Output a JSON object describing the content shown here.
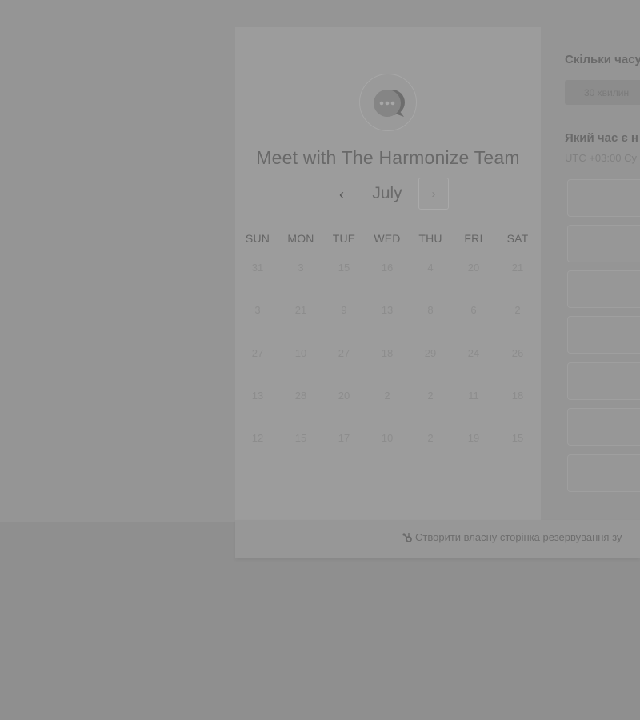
{
  "calendar": {
    "title": "Meet with The Harmonize Team",
    "month": "July",
    "prev_icon": "chevron-left-icon",
    "next_icon": "chevron-right-icon",
    "prev_glyph": "‹",
    "next_glyph": "›",
    "weekdays": [
      "SUN",
      "MON",
      "TUE",
      "WED",
      "THU",
      "FRI",
      "SAT"
    ],
    "days": [
      [
        "31",
        "3",
        "15",
        "16",
        "4",
        "20",
        "21"
      ],
      [
        "3",
        "21",
        "9",
        "13",
        "8",
        "6",
        "2"
      ],
      [
        "27",
        "10",
        "27",
        "18",
        "29",
        "24",
        "26"
      ],
      [
        "13",
        "28",
        "20",
        "2",
        "2",
        "11",
        "18"
      ],
      [
        "12",
        "15",
        "17",
        "10",
        "2",
        "19",
        "15"
      ]
    ]
  },
  "booking": {
    "duration_heading": "Скільки часу",
    "duration_option": "30 хвилин",
    "time_heading": "Який час є н",
    "timezone": "UTC +03:00 Су"
  },
  "footer": {
    "link_text": "Створити власну сторінка резервування зу",
    "icon": "hubspot-sprocket-icon"
  },
  "colors": {
    "overlay": "#8f8f8f",
    "card": "#9c9c9c",
    "text_dark": "#696969"
  }
}
